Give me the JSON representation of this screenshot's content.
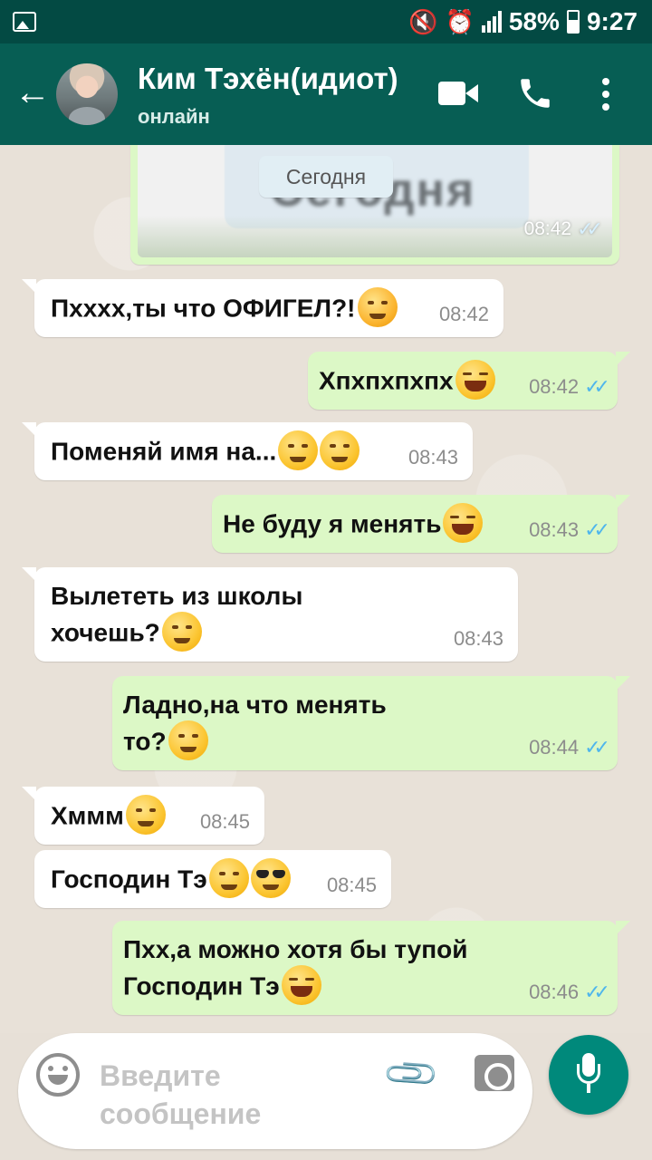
{
  "status_bar": {
    "battery": "58%",
    "time": "9:27"
  },
  "header": {
    "contact_name": "Ким Тэхён(идиот)",
    "contact_status": "онлайн"
  },
  "image_message": {
    "date_chip": "Сегодня",
    "blurred_text": "Сегодня",
    "time": "08:42",
    "ticks": "✓✓"
  },
  "messages": [
    {
      "direction": "in",
      "text": "Пхххх,ты что ОФИГЕЛ?!",
      "emojis": [
        "angry"
      ],
      "time": "08:42"
    },
    {
      "direction": "out",
      "text": "Хпхпхпхпх",
      "emojis": [
        "laugh"
      ],
      "time": "08:42",
      "ticks": "✓✓"
    },
    {
      "direction": "in",
      "text": "Поменяй имя на...",
      "emojis": [
        "thinking",
        "smirk"
      ],
      "time": "08:43"
    },
    {
      "direction": "out",
      "text": "Не буду я менять",
      "emojis": [
        "laugh"
      ],
      "time": "08:43",
      "ticks": "✓✓"
    },
    {
      "direction": "in",
      "text_line1": "Вылететь из школы",
      "text_line2": "хочешь?",
      "emojis": [
        "smirk"
      ],
      "time": "08:43"
    },
    {
      "direction": "out",
      "text_line1": "Ладно,на что менять",
      "text_line2": "то?",
      "emojis": [
        "unamused"
      ],
      "time": "08:44",
      "ticks": "✓✓"
    },
    {
      "direction": "in",
      "text": "Хммм",
      "emojis": [
        "smirk"
      ],
      "time": "08:45"
    },
    {
      "direction": "in",
      "text": "Господин Тэ",
      "emojis": [
        "smirk",
        "cool"
      ],
      "time": "08:45"
    },
    {
      "direction": "out",
      "text_line1": "Пхх,а можно хотя бы тупой",
      "text_line2": "Господин Тэ",
      "emojis": [
        "laugh"
      ],
      "time": "08:46",
      "ticks": "✓✓"
    }
  ],
  "input": {
    "placeholder": "Введите сообщение"
  },
  "colors": {
    "header": "#075e54",
    "status_bar": "#034a43",
    "outgoing": "#dcf8c6",
    "incoming": "#ffffff",
    "ticks": "#4fb6ec",
    "mic_button": "#00897b"
  }
}
